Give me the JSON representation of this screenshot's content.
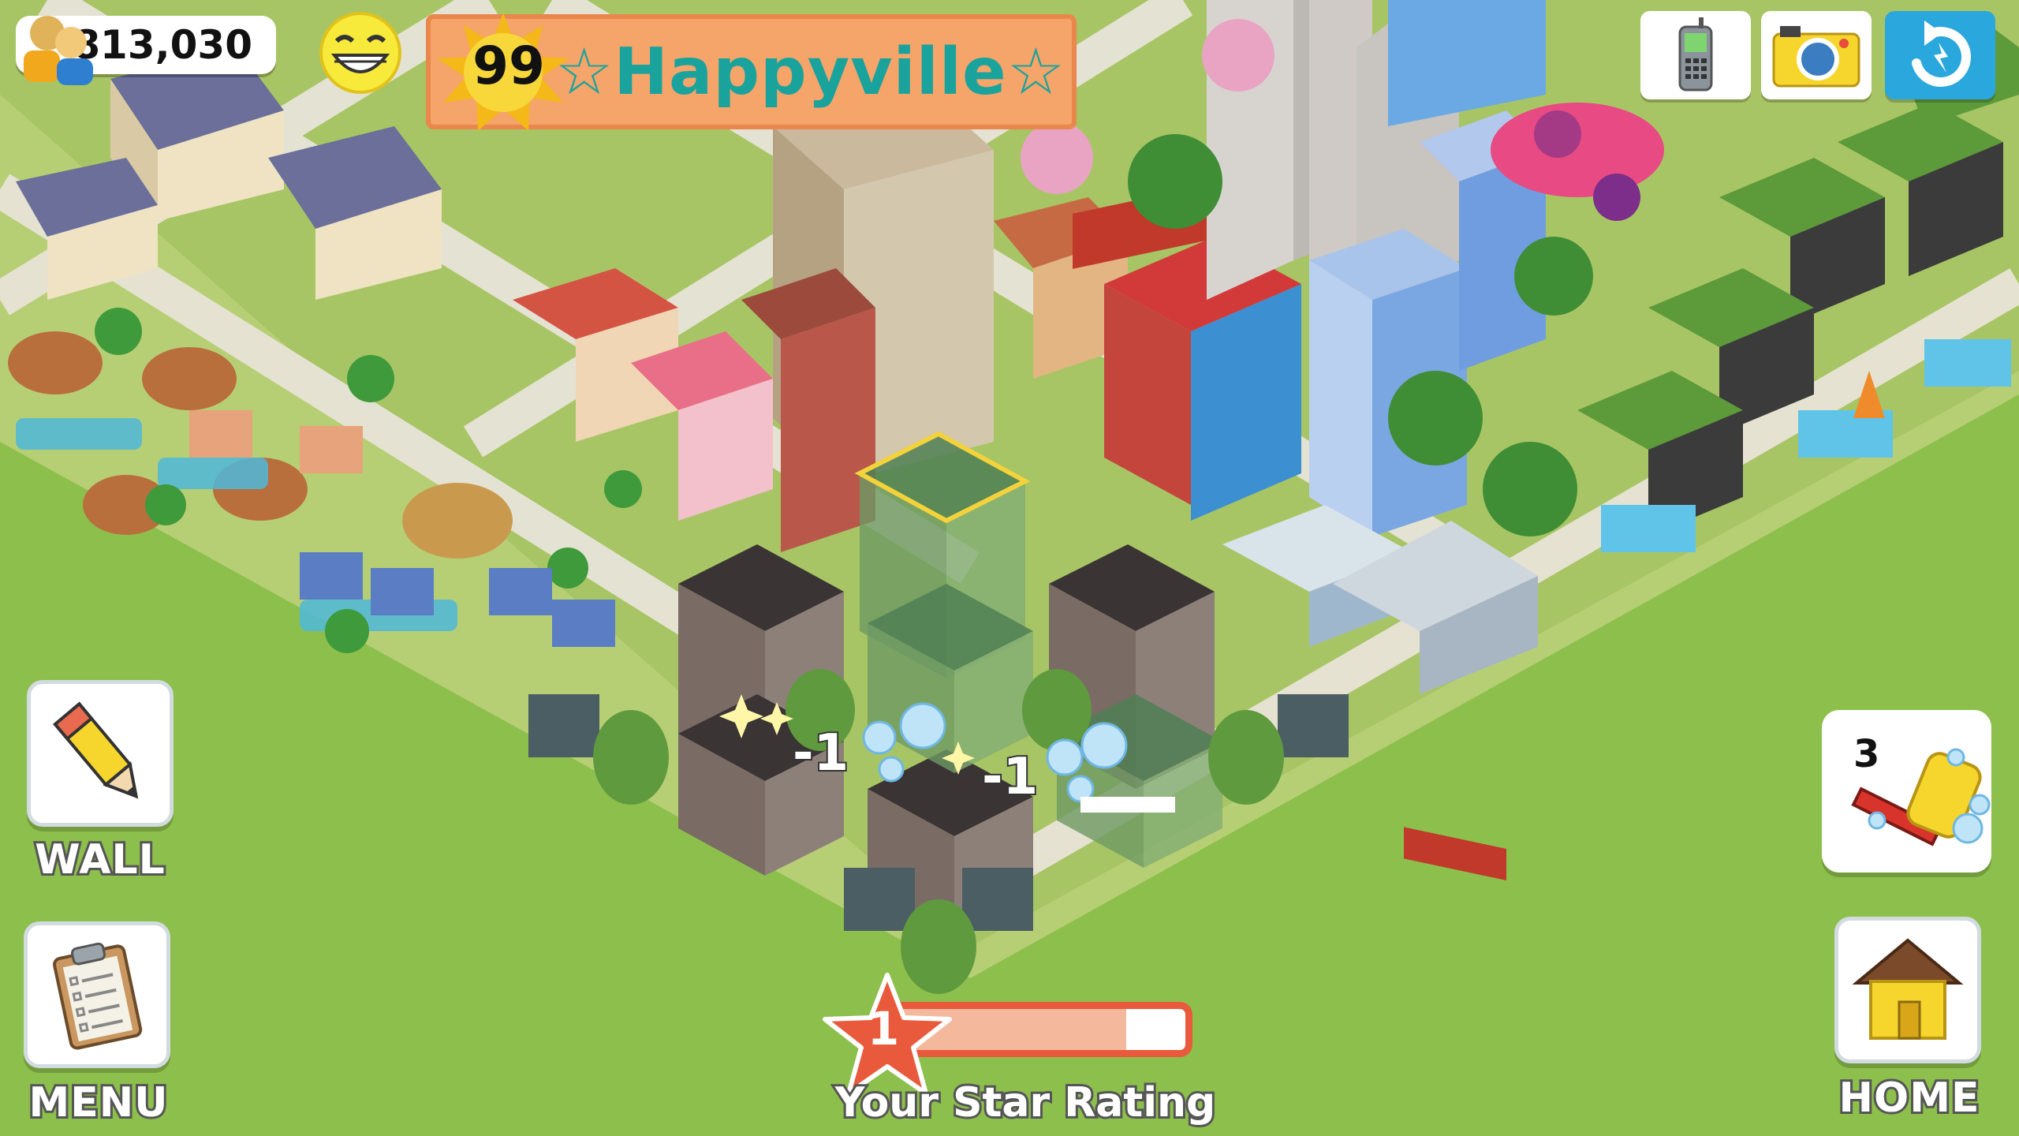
{
  "hud": {
    "population": "813,030",
    "level": "99",
    "town_name": "☆Happyville☆",
    "mood_icon": "happy-face-icon",
    "buttons": {
      "phone_icon": "phone-icon",
      "camera_icon": "camera-icon",
      "settings_icon": "rotate-arrow-icon"
    }
  },
  "left_panel": {
    "wall_label": "WALL",
    "menu_label": "MENU"
  },
  "right_panel": {
    "clean_count": "3",
    "home_label": "HOME"
  },
  "star_rating": {
    "value": "1",
    "label": "Your Star Rating",
    "progress": 0.8
  },
  "floating_numbers": [
    "-1",
    "-1"
  ],
  "colors": {
    "grass": "#8dbf4c",
    "banner": "#f5a46a",
    "town_name": "#1aa39c",
    "star": "#e95a3d"
  }
}
